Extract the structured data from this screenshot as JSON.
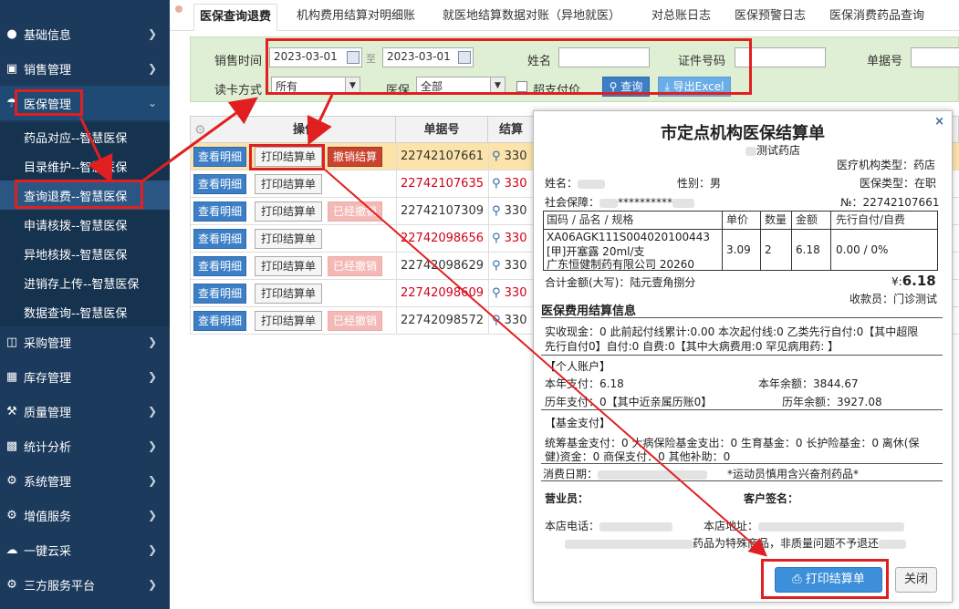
{
  "sidebar": {
    "top_text": "",
    "items": [
      {
        "label": "基础信息",
        "icon": "user-icon"
      },
      {
        "label": "销售管理",
        "icon": "monitor-icon"
      },
      {
        "label": "医保管理",
        "icon": "umbrella-icon"
      },
      {
        "label": "采购管理",
        "icon": "cart-icon"
      },
      {
        "label": "库存管理",
        "icon": "grid-icon"
      },
      {
        "label": "质量管理",
        "icon": "gavel-icon"
      },
      {
        "label": "统计分析",
        "icon": "bar-chart-icon"
      },
      {
        "label": "系统管理",
        "icon": "gear-icon"
      },
      {
        "label": "增值服务",
        "icon": "gear-icon"
      },
      {
        "label": "一键云采",
        "icon": "cloud-icon"
      },
      {
        "label": "三方服务平台",
        "icon": "gear-icon"
      }
    ],
    "subitems": [
      "药品对应--智慧医保",
      "目录维护--智慧医保",
      "查询退费--智慧医保",
      "申请核拨--智慧医保",
      "异地核拨--智慧医保",
      "进销存上传--智慧医保",
      "数据查询--智慧医保"
    ]
  },
  "tabs": [
    "医保查询退费",
    "机构费用结算对明细账",
    "就医地结算数据对账（异地就医）",
    "对总账日志",
    "医保预警日志",
    "医保消费药品查询"
  ],
  "filter": {
    "sale_time_label": "销售时间",
    "date_from": "2023-03-01",
    "to_label": "至",
    "date_to": "2023-03-01",
    "name_label": "姓名",
    "id_label": "证件号码",
    "bill_label": "单据号",
    "read_label": "读卡方式",
    "read_value": "所有",
    "insurance_label": "医保",
    "insurance_value": "全部",
    "over_label": "超支付价",
    "query_btn": "查询",
    "export_btn": "导出Excel"
  },
  "table": {
    "headers": {
      "op": "操作",
      "bill": "单据号",
      "settle": "结算"
    },
    "btn_view": "查看明细",
    "btn_print": "打印结算单",
    "btn_cancel": "撤销结算",
    "btn_canceled": "已经撤销",
    "rows": [
      {
        "bill": "22742107661",
        "red": false,
        "status": "cancel",
        "settle": "330"
      },
      {
        "bill": "22742107635",
        "red": true,
        "status": "none",
        "settle": "330"
      },
      {
        "bill": "22742107309",
        "red": false,
        "status": "canceled",
        "settle": "330"
      },
      {
        "bill": "22742098656",
        "red": true,
        "status": "none",
        "settle": "330"
      },
      {
        "bill": "22742098629",
        "red": false,
        "status": "canceled",
        "settle": "330"
      },
      {
        "bill": "22742098609",
        "red": true,
        "status": "none",
        "settle": "330"
      },
      {
        "bill": "22742098572",
        "red": false,
        "status": "canceled",
        "settle": "330"
      }
    ]
  },
  "modal": {
    "title": "市定点机构医保结算单",
    "store": "测试药店",
    "org_type": "医疗机构类型：药店",
    "name_label": "姓名：",
    "gender": "性别：男",
    "ins_type": "医保类型：在职",
    "social_label": "社会保障：",
    "social_mask": "**********",
    "no": "№：22742107661",
    "th_name": "国码 / 品名 / 规格",
    "th_price": "单价",
    "th_qty": "数量",
    "th_amount": "金额",
    "th_first": "先行自付/自费",
    "drug_code": "XA06AGK111S004020100443",
    "drug_name": "[甲]开塞露 20ml/支",
    "drug_maker": "广东恒健制药有限公司 20260",
    "drug_price": "3.09",
    "drug_qty": "2",
    "drug_amount": "6.18",
    "drug_first": "0.00 / 0%",
    "total_words": "合计金额(大写)：陆元壹角捌分",
    "total_symbol": "¥:",
    "total_value": "6.18",
    "cashier": "收款员：门诊测试",
    "section_info": "医保费用结算信息",
    "cash_line1": "实收现金：0   此前起付线累计:0.00  本次起付线:0  乙类先行自付:0【其中超限",
    "cash_line2": "先行自付0】自付:0  自费:0【其中大病费用:0 罕见病用药: 】",
    "personal_section": "【个人账户】",
    "year_pay": "本年支付：6.18",
    "year_balance": "本年余额：3844.67",
    "hist_pay": "历年支付：0【其中近亲属历账0】",
    "hist_balance": "历年余额：3927.08",
    "fund_section": "【基金支付】",
    "fund_line1": "统筹基金支付：0  大病保险基金支出：0  生育基金：0  长护险基金：0  离休(保",
    "fund_line2": "健)资金：0  商保支付：0  其他补助：0",
    "consume_date": "消费日期：",
    "sport_note": "*运动员慎用含兴奋剂药品*",
    "salesman": "营业员：",
    "customer_sign": "客户签名：",
    "store_phone": "本店电话：",
    "store_addr": "本店地址：",
    "special_note": "药品为特殊商品，非质量问题不予退还",
    "print_btn": "打印结算单",
    "close_btn": "关闭",
    "close_x": "×"
  }
}
